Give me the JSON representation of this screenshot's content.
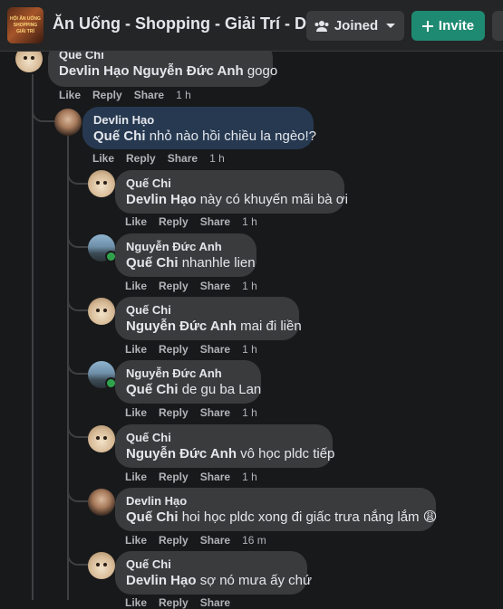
{
  "header": {
    "group_title": "Ăn Uống - Shopping - Giải Trí - D...",
    "thumb_lines": [
      "HỘI ĂN UỐNG",
      "SHOPPING",
      "GIẢI TRÍ"
    ],
    "joined_label": "Joined",
    "invite_label": "Invite"
  },
  "actions": {
    "like": "Like",
    "reply": "Reply",
    "share": "Share"
  },
  "comments": [
    {
      "author": "Quế Chi",
      "mention": "Devlin Hạo Nguyễn Đức Anh",
      "text": "gogo",
      "time": "1 h"
    },
    {
      "author": "Devlin Hạo",
      "mention": "Quế Chi",
      "text": "nhỏ nào hồi chiều la ngèo!?",
      "time": "1 h"
    },
    {
      "author": "Quế Chi",
      "mention": "Devlin Hạo",
      "text": "này có khuyến mãi bà ơi",
      "time": "1 h"
    },
    {
      "author": "Nguyễn Đức Anh",
      "mention": "Quế Chi",
      "text": "nhanhle lien",
      "time": "1 h"
    },
    {
      "author": "Quế Chi",
      "mention": "Nguyễn Đức Anh",
      "text": "mai đi liền",
      "time": "1 h"
    },
    {
      "author": "Nguyễn Đức Anh",
      "mention": "Quế Chi",
      "text": "de gu ba Lan",
      "time": "1 h"
    },
    {
      "author": "Quế Chi",
      "mention": "Nguyễn Đức Anh",
      "text": "vô học pldc tiếp",
      "time": "1 h"
    },
    {
      "author": "Devlin Hạo",
      "mention": "Quế Chi",
      "text": "hoi học pldc xong đi giấc trưa nắng lắm 😩",
      "time": "16 m"
    },
    {
      "author": "Quế Chi",
      "mention": "Devlin Hạo",
      "text": "sợ nó mưa ấy chứ",
      "time": ""
    }
  ],
  "icons": [
    "group-members-icon",
    "chevron-down-icon",
    "plus-icon"
  ],
  "colors": {
    "background": "#18191a",
    "bubble": "#3a3b3c",
    "highlight_bubble": "#263951",
    "invite": "#1f8a72",
    "online": "#31a24c"
  }
}
